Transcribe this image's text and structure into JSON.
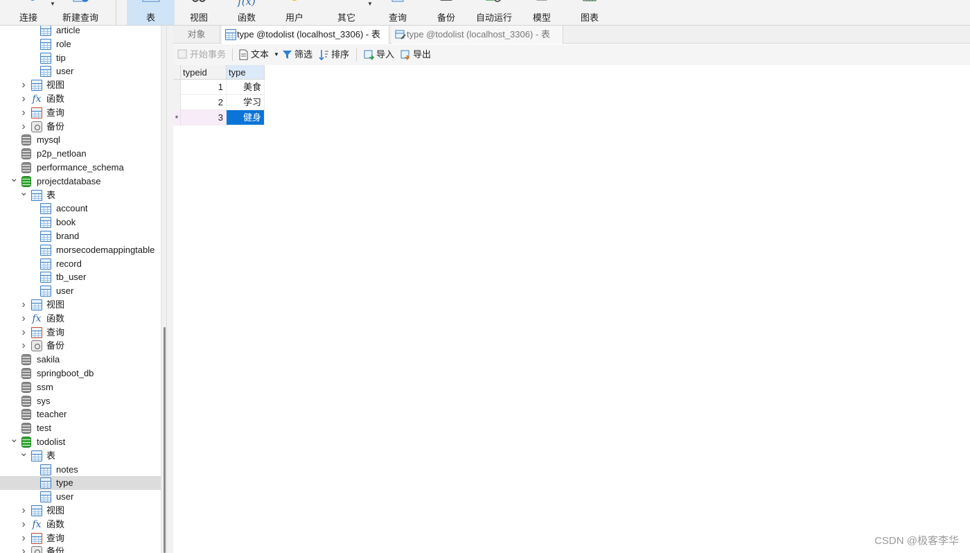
{
  "ribbon": {
    "items": [
      {
        "label": "连接",
        "icon": "plug-icon"
      },
      {
        "label": "新建查询",
        "icon": "new-query-icon"
      },
      {
        "label": "表",
        "icon": "table-icon",
        "active": true
      },
      {
        "label": "视图",
        "icon": "view-icon"
      },
      {
        "label": "函数",
        "icon": "function-icon"
      },
      {
        "label": "用户",
        "icon": "user-icon"
      },
      {
        "label": "其它",
        "icon": "other-icon"
      },
      {
        "label": "查询",
        "icon": "query-icon"
      },
      {
        "label": "备份",
        "icon": "backup-icon"
      },
      {
        "label": "自动运行",
        "icon": "schedule-icon"
      },
      {
        "label": "模型",
        "icon": "model-icon"
      },
      {
        "label": "图表",
        "icon": "chart-icon"
      }
    ]
  },
  "tree": {
    "rows": [
      {
        "label": "article",
        "icon": "table"
      },
      {
        "label": "role",
        "icon": "table"
      },
      {
        "label": "tip",
        "icon": "table"
      },
      {
        "label": "user",
        "icon": "table"
      },
      {
        "label": "视图",
        "icon": "view"
      },
      {
        "label": "函数",
        "icon": "function"
      },
      {
        "label": "查询",
        "icon": "query"
      },
      {
        "label": "备份",
        "icon": "backup"
      },
      {
        "label": "mysql",
        "icon": "db-grey"
      },
      {
        "label": "p2p_netloan",
        "icon": "db-grey"
      },
      {
        "label": "performance_schema",
        "icon": "db-grey"
      },
      {
        "label": "projectdatabase",
        "icon": "db-green"
      },
      {
        "label": "表",
        "icon": "table"
      },
      {
        "label": "account",
        "icon": "table"
      },
      {
        "label": "book",
        "icon": "table"
      },
      {
        "label": "brand",
        "icon": "table"
      },
      {
        "label": "morsecodemappingtable",
        "icon": "table"
      },
      {
        "label": "record",
        "icon": "table"
      },
      {
        "label": "tb_user",
        "icon": "table"
      },
      {
        "label": "user",
        "icon": "table"
      },
      {
        "label": "视图",
        "icon": "view"
      },
      {
        "label": "函数",
        "icon": "function"
      },
      {
        "label": "查询",
        "icon": "query"
      },
      {
        "label": "备份",
        "icon": "backup"
      },
      {
        "label": "sakila",
        "icon": "db-grey"
      },
      {
        "label": "springboot_db",
        "icon": "db-grey"
      },
      {
        "label": "ssm",
        "icon": "db-grey"
      },
      {
        "label": "sys",
        "icon": "db-grey"
      },
      {
        "label": "teacher",
        "icon": "db-grey"
      },
      {
        "label": "test",
        "icon": "db-grey"
      },
      {
        "label": "todolist",
        "icon": "db-green"
      },
      {
        "label": "表",
        "icon": "table"
      },
      {
        "label": "notes",
        "icon": "table"
      },
      {
        "label": "type",
        "icon": "table",
        "selected": true
      },
      {
        "label": "user",
        "icon": "table"
      },
      {
        "label": "视图",
        "icon": "view"
      },
      {
        "label": "函数",
        "icon": "function"
      },
      {
        "label": "查询",
        "icon": "query"
      },
      {
        "label": "备份",
        "icon": "backup"
      }
    ]
  },
  "tabs": {
    "objects": "对象",
    "tab1": "type @todolist (localhost_3306) - 表",
    "tab2": "type @todolist (localhost_3306) - 表"
  },
  "editor_toolbar": {
    "begin_transaction": "开始事务",
    "text": "文本",
    "filter": "筛选",
    "sort": "排序",
    "import": "导入",
    "export": "导出"
  },
  "grid": {
    "columns": [
      "typeid",
      "type"
    ],
    "rows": [
      {
        "indicator": "",
        "typeid": "1",
        "type": "美食"
      },
      {
        "indicator": "",
        "typeid": "2",
        "type": "学习"
      },
      {
        "indicator": "*",
        "typeid": "3",
        "type": "健身"
      }
    ],
    "active_color": "#0a74d8"
  },
  "watermark": "CSDN @极客李华"
}
